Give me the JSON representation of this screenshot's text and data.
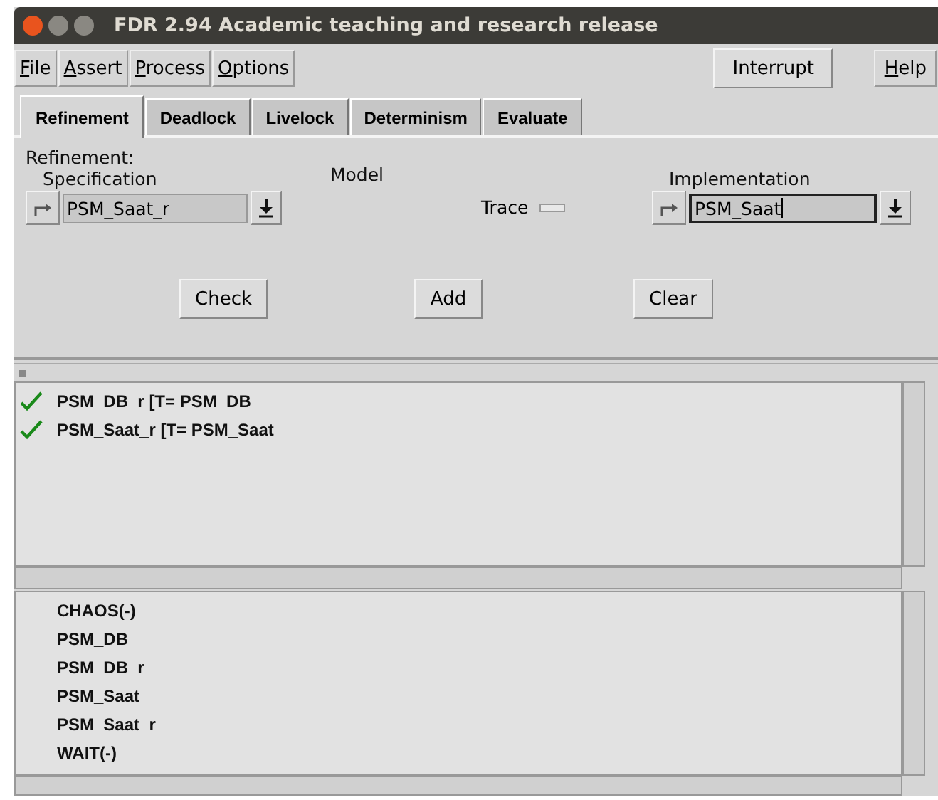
{
  "window": {
    "title": "FDR 2.94 Academic teaching and research release"
  },
  "menu": [
    "File",
    "Assert",
    "Process",
    "Options"
  ],
  "toolbar_buttons": [
    "Interrupt"
  ],
  "help_menu": "Help",
  "tabs": [
    {
      "label": "Refinement",
      "selected": true
    },
    {
      "label": "Deadlock",
      "selected": false
    },
    {
      "label": "Livelock",
      "selected": false
    },
    {
      "label": "Determinism",
      "selected": false
    },
    {
      "label": "Evaluate",
      "selected": false
    }
  ],
  "refinement": {
    "heading": "Refinement:",
    "specification": {
      "label": "Specification",
      "value": "PSM_Saat_r",
      "focused": false
    },
    "model": {
      "label": "Model",
      "value": "Trace"
    },
    "implementation": {
      "label": "Implementation",
      "value": "PSM_Saat",
      "focused": true
    },
    "buttons": [
      "Check",
      "Add",
      "Clear"
    ]
  },
  "assertions": [
    {
      "text": "PSM_DB_r [T= PSM_DB",
      "passed": true
    },
    {
      "text": "PSM_Saat_r [T= PSM_Saat",
      "passed": true
    }
  ],
  "processes": [
    "CHAOS(-)",
    "PSM_DB",
    "PSM_DB_r",
    "PSM_Saat",
    "PSM_Saat_r",
    "WAIT(-)"
  ]
}
